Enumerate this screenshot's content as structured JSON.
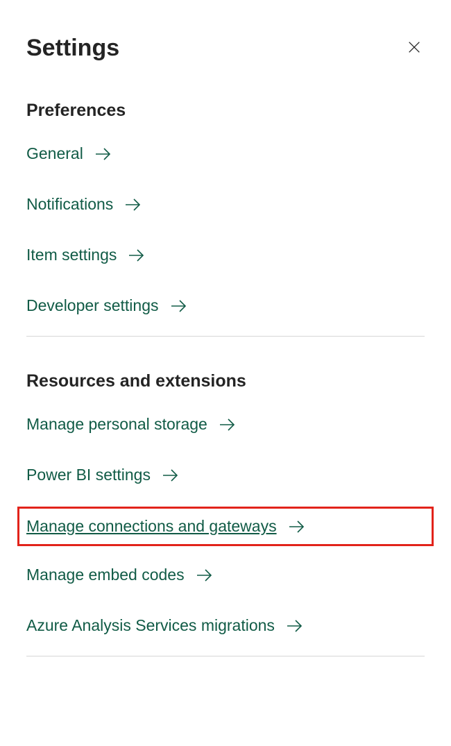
{
  "panel": {
    "title": "Settings"
  },
  "sections": {
    "preferences": {
      "title": "Preferences",
      "items": [
        {
          "label": "General"
        },
        {
          "label": "Notifications"
        },
        {
          "label": "Item settings"
        },
        {
          "label": "Developer settings"
        }
      ]
    },
    "resources": {
      "title": "Resources and extensions",
      "items": [
        {
          "label": "Manage personal storage"
        },
        {
          "label": "Power BI settings"
        },
        {
          "label": "Manage connections and gateways"
        },
        {
          "label": "Manage embed codes"
        },
        {
          "label": "Azure Analysis Services migrations"
        }
      ]
    }
  }
}
